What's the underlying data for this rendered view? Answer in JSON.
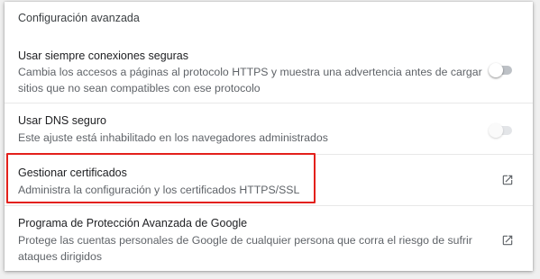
{
  "section": {
    "title": "Configuración avanzada"
  },
  "settings": [
    {
      "title": "Usar siempre conexiones seguras",
      "description": "Cambia los accesos a páginas al protocolo HTTPS y muestra una advertencia antes de cargar sitios que no sean compatibles con ese protocolo",
      "control": "toggle",
      "state": "off"
    },
    {
      "title": "Usar DNS seguro",
      "description": "Este ajuste está inhabilitado en los navegadores administrados",
      "control": "toggle",
      "state": "off-disabled"
    },
    {
      "title": "Gestionar certificados",
      "description": "Administra la configuración y los certificados HTTPS/SSL",
      "control": "open-in-new-icon",
      "highlighted": true
    },
    {
      "title": "Programa de Protección Avanzada de Google",
      "description": "Protege las cuentas personales de Google de cualquier persona que corra el riesgo de sufrir ataques dirigidos",
      "control": "open-in-new-icon"
    }
  ],
  "colors": {
    "highlight": "#e3201b",
    "toggle_off": "#bdc1c6",
    "secondary_text": "#5f6368"
  }
}
